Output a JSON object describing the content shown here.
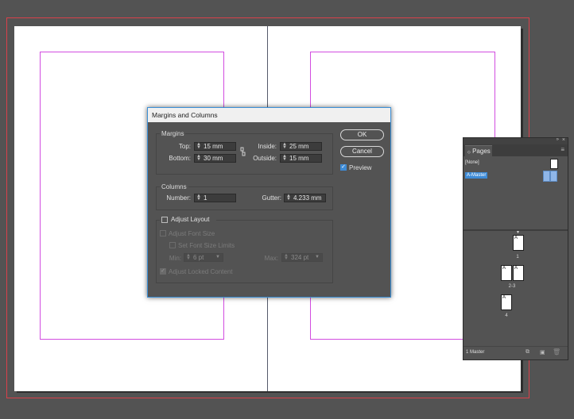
{
  "dialog": {
    "title": "Margins and Columns",
    "margins": {
      "legend": "Margins",
      "top_label": "Top:",
      "top_value": "15 mm",
      "bottom_label": "Bottom:",
      "bottom_value": "30 mm",
      "inside_label": "Inside:",
      "inside_value": "25 mm",
      "outside_label": "Outside:",
      "outside_value": "15 mm"
    },
    "columns": {
      "legend": "Columns",
      "number_label": "Number:",
      "number_value": "1",
      "gutter_label": "Gutter:",
      "gutter_value": "4.233 mm"
    },
    "adjust_layout": {
      "label": "Adjust Layout",
      "checked": false,
      "adjust_font_size_label": "Adjust Font Size",
      "set_font_size_limits_label": "Set Font Size Limits",
      "min_label": "Min:",
      "min_value": "6 pt",
      "max_label": "Max:",
      "max_value": "324 pt",
      "adjust_locked_content_label": "Adjust Locked Content"
    },
    "ok_label": "OK",
    "cancel_label": "Cancel",
    "preview_label": "Preview",
    "preview_checked": true
  },
  "pages_panel": {
    "tab_label": "Pages",
    "none_label": "[None]",
    "master_label": "A-Master",
    "page_prefix": "A",
    "page_numbers": [
      "1",
      "2-3",
      "4"
    ],
    "footer_label": "1 Master"
  },
  "colors": {
    "accent": "#3e8bd6",
    "margin_guide": "#d24de0",
    "bleed": "#d8404a"
  }
}
